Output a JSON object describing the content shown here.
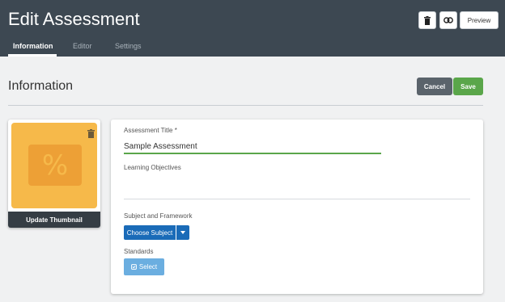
{
  "header": {
    "title": "Edit Assessment",
    "tabs": [
      {
        "label": "Information",
        "active": true
      },
      {
        "label": "Editor",
        "active": false
      },
      {
        "label": "Settings",
        "active": false
      }
    ],
    "delete_icon": "trash-icon",
    "link_icon": "link-icon",
    "preview_label": "Preview"
  },
  "section": {
    "title": "Information",
    "cancel_label": "Cancel",
    "save_label": "Save"
  },
  "thumbnail": {
    "glyph": "%",
    "update_label": "Update Thumbnail",
    "delete_icon": "trash-icon"
  },
  "form": {
    "title_label": "Assessment Title *",
    "title_value": "Sample Assessment",
    "objectives_label": "Learning Objectives",
    "subject_label": "Subject and Framework",
    "choose_subject_label": "Choose Subject",
    "standards_label": "Standards",
    "select_label": "Select"
  },
  "colors": {
    "header_bg": "#3d4852",
    "save_green": "#5aa64a",
    "cancel_gray": "#5a636b",
    "primary_blue": "#1a6bb8",
    "select_blue": "#6baee0",
    "thumb_orange": "#f6b94a"
  }
}
